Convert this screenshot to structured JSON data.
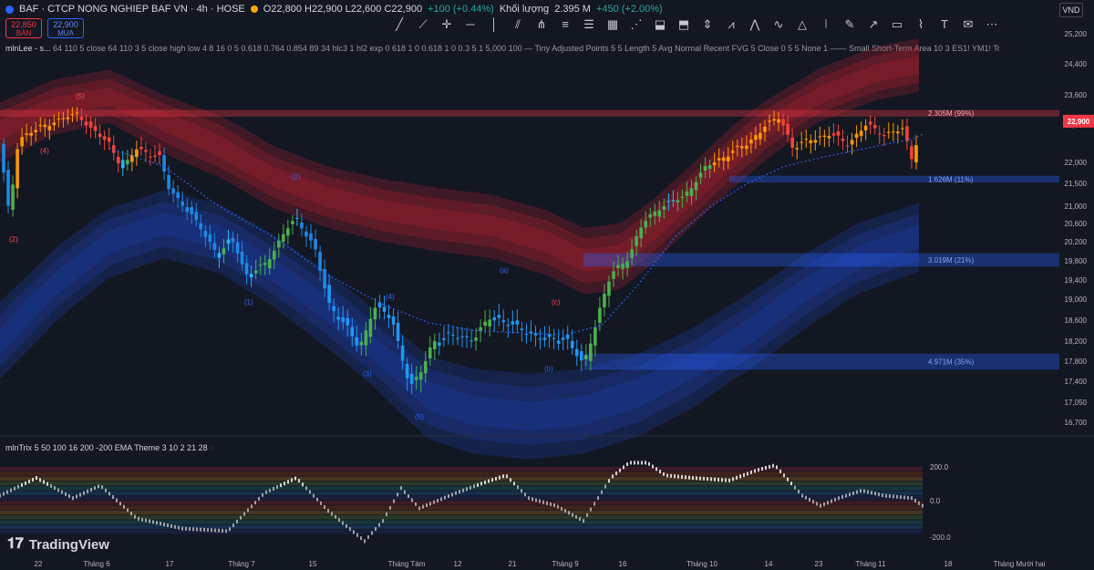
{
  "header": {
    "symbol": "BAF · CTCP NONG NGHIEP BAF VN · 4h · HOSE",
    "ohlc": "O22,800 H22,900 L22,600 C22,900",
    "change": "+100 (+0.44%)",
    "volume_label": "Khối lượng",
    "volume": "2.395 M",
    "volume_change": "+450 (+2.00%)"
  },
  "trade": {
    "sell_price": "22,850",
    "sell_label": "BÁN",
    "buy_price": "22,900",
    "buy_label": "MUA"
  },
  "currency": "VND",
  "indicator_1": {
    "name": "mlnLee - s...",
    "params": "64 110 5 close 64 110 3 5 close high low 4 8 16 0 5 0.618 0.764 0.854 89 34 hlc3 1 hl2 exp 0 618 1 0 0.618 1 0 0.3 5 1 5,000 100 — Tiny Adjusted Points 5 5 Length 5 Avg Normal Recent FVG 5 Close 0 5 5 None 1 —— Small Short-Term Area 10 3 ES1! YM1! Top Right S..."
  },
  "indicator_2": {
    "name": "mlnTrix 5 50 100 16 200 -200 EMA Theme 3 10 2 21 28"
  },
  "tradingview_label": "TradingView",
  "colors": {
    "bg": "#131722",
    "red_band": "#b2222f",
    "blue_band": "#1e40b0",
    "price_tag": "#f23645",
    "grid": "#2a2e39"
  },
  "zones": [
    {
      "label": "2.305M (99%)",
      "top": 23200,
      "bottom": 23020,
      "color": "#f23645"
    },
    {
      "label": "1.626M (11%)",
      "top": 21680,
      "bottom": 21520,
      "color": "#2962ff"
    },
    {
      "label": "3.019M (21%)",
      "top": 19960,
      "bottom": 19680,
      "color": "#2962ff"
    },
    {
      "label": "4.971M (35%)",
      "top": 17950,
      "bottom": 17630,
      "color": "#2962ff"
    }
  ],
  "wave_labels": [
    {
      "text": "(5)",
      "date_index": 83,
      "price": 23500,
      "color": "#ef5350"
    },
    {
      "text": "(4)",
      "date_index": 44,
      "price": 22200,
      "color": "#ef5350"
    },
    {
      "text": "(2)",
      "date_index": 10,
      "price": 20200,
      "color": "#ef5350"
    },
    {
      "text": "(2)",
      "date_index": 320,
      "price": 21600,
      "color": "#2962ff"
    },
    {
      "text": "(1)",
      "date_index": 268,
      "price": 18900,
      "color": "#2962ff"
    },
    {
      "text": "(4)",
      "date_index": 423,
      "price": 19000,
      "color": "#2962ff"
    },
    {
      "text": "(3)",
      "date_index": 398,
      "price": 17500,
      "color": "#2962ff"
    },
    {
      "text": "(5)",
      "date_index": 455,
      "price": 16750,
      "color": "#2962ff"
    },
    {
      "text": "(a)",
      "date_index": 548,
      "price": 19550,
      "color": "#2962ff"
    },
    {
      "text": "(b)",
      "date_index": 597,
      "price": 17600,
      "color": "#2962ff"
    },
    {
      "text": "(c)",
      "date_index": 605,
      "price": 18900,
      "color": "#ef5350"
    }
  ],
  "chart_data": {
    "type": "candlestick",
    "y_ticks": [
      25200,
      24400,
      23600,
      22800,
      22000,
      21500,
      21000,
      20600,
      20200,
      19800,
      19400,
      19000,
      18600,
      18200,
      17800,
      17400,
      17050,
      16700
    ],
    "y_tick_labels": [
      "25,200",
      "24,400",
      "23,600",
      "22,800",
      "22,000",
      "21,500",
      "21,000",
      "20,600",
      "20,200",
      "19,800",
      "19,400",
      "19,000",
      "18,600",
      "18,200",
      "17,800",
      "17,400",
      "17,050",
      "16,700"
    ],
    "ylim": [
      16550,
      25400
    ],
    "last_price": 22900,
    "last_price_label": "22,900",
    "x_tick_labels": [
      "22",
      "Tháng 6",
      "17",
      "Tháng 7",
      "15",
      "Tháng Tám",
      "12",
      "21",
      "Tháng 9",
      "16",
      "Tháng 10",
      "14",
      "23",
      "Tháng 11",
      "18",
      "Tháng Mười hai"
    ],
    "close_path": [
      [
        0,
        22350
      ],
      [
        10,
        20800
      ],
      [
        20,
        22500
      ],
      [
        40,
        22700
      ],
      [
        60,
        22900
      ],
      [
        85,
        23100
      ],
      [
        100,
        22700
      ],
      [
        120,
        22400
      ],
      [
        135,
        21850
      ],
      [
        150,
        22300
      ],
      [
        175,
        22100
      ],
      [
        185,
        21400
      ],
      [
        200,
        21050
      ],
      [
        220,
        20500
      ],
      [
        240,
        19900
      ],
      [
        255,
        20300
      ],
      [
        270,
        19500
      ],
      [
        290,
        19700
      ],
      [
        315,
        20500
      ],
      [
        325,
        20700
      ],
      [
        345,
        20100
      ],
      [
        360,
        18900
      ],
      [
        380,
        18500
      ],
      [
        395,
        18000
      ],
      [
        410,
        18900
      ],
      [
        430,
        18600
      ],
      [
        450,
        17300
      ],
      [
        460,
        17500
      ],
      [
        475,
        18200
      ],
      [
        495,
        18300
      ],
      [
        520,
        18250
      ],
      [
        540,
        18700
      ],
      [
        560,
        18500
      ],
      [
        575,
        18400
      ],
      [
        600,
        18200
      ],
      [
        620,
        18300
      ],
      [
        640,
        17700
      ],
      [
        655,
        18650
      ],
      [
        670,
        19500
      ],
      [
        690,
        19900
      ],
      [
        705,
        20600
      ],
      [
        725,
        21000
      ],
      [
        750,
        21200
      ],
      [
        775,
        21900
      ],
      [
        800,
        22200
      ],
      [
        820,
        22400
      ],
      [
        840,
        22800
      ],
      [
        855,
        23000
      ],
      [
        870,
        22300
      ],
      [
        890,
        22500
      ],
      [
        910,
        22600
      ],
      [
        930,
        22400
      ],
      [
        950,
        22800
      ],
      [
        970,
        22600
      ],
      [
        990,
        22700
      ],
      [
        1000,
        22100
      ],
      [
        1012,
        22900
      ]
    ],
    "ema_path": [
      [
        120,
        22300
      ],
      [
        180,
        21900
      ],
      [
        240,
        21000
      ],
      [
        300,
        20300
      ],
      [
        360,
        19500
      ],
      [
        420,
        18900
      ],
      [
        470,
        18550
      ],
      [
        520,
        18400
      ],
      [
        580,
        18350
      ],
      [
        620,
        18320
      ],
      [
        660,
        18500
      ],
      [
        700,
        19300
      ],
      [
        740,
        20300
      ],
      [
        780,
        21000
      ],
      [
        820,
        21500
      ],
      [
        860,
        21900
      ],
      [
        900,
        22100
      ],
      [
        950,
        22300
      ],
      [
        1000,
        22500
      ],
      [
        1012,
        22600
      ]
    ],
    "red_band": [
      [
        0,
        22700
      ],
      [
        60,
        23300
      ],
      [
        120,
        23550
      ],
      [
        180,
        22900
      ],
      [
        240,
        22350
      ],
      [
        300,
        21650
      ],
      [
        360,
        21200
      ],
      [
        420,
        20900
      ],
      [
        480,
        20700
      ],
      [
        540,
        20550
      ],
      [
        600,
        20200
      ],
      [
        640,
        19800
      ],
      [
        680,
        19900
      ],
      [
        720,
        20500
      ],
      [
        780,
        21650
      ],
      [
        840,
        22750
      ],
      [
        900,
        23600
      ],
      [
        960,
        24150
      ],
      [
        1012,
        24400
      ]
    ],
    "blue_band": [
      [
        0,
        18200
      ],
      [
        60,
        19300
      ],
      [
        120,
        20200
      ],
      [
        180,
        20600
      ],
      [
        240,
        20300
      ],
      [
        300,
        19600
      ],
      [
        360,
        18800
      ],
      [
        420,
        17900
      ],
      [
        470,
        17150
      ],
      [
        520,
        16900
      ],
      [
        580,
        16800
      ],
      [
        640,
        16900
      ],
      [
        700,
        17200
      ],
      [
        760,
        17700
      ],
      [
        820,
        18350
      ],
      [
        880,
        19150
      ],
      [
        940,
        19850
      ],
      [
        1012,
        20350
      ]
    ],
    "trix_path": [
      [
        0,
        0.2
      ],
      [
        40,
        0.9
      ],
      [
        80,
        0.1
      ],
      [
        110,
        0.6
      ],
      [
        150,
        -0.7
      ],
      [
        200,
        -1.1
      ],
      [
        250,
        -1.2
      ],
      [
        290,
        0.3
      ],
      [
        325,
        0.9
      ],
      [
        360,
        -0.4
      ],
      [
        400,
        -1.6
      ],
      [
        420,
        -0.8
      ],
      [
        440,
        0.5
      ],
      [
        460,
        -0.3
      ],
      [
        500,
        0.3
      ],
      [
        530,
        0.7
      ],
      [
        555,
        1.0
      ],
      [
        580,
        0.1
      ],
      [
        610,
        -0.2
      ],
      [
        640,
        -0.8
      ],
      [
        670,
        0.9
      ],
      [
        690,
        1.5
      ],
      [
        710,
        1.5
      ],
      [
        730,
        1.0
      ],
      [
        760,
        0.9
      ],
      [
        800,
        0.8
      ],
      [
        830,
        1.2
      ],
      [
        850,
        1.4
      ],
      [
        880,
        0.2
      ],
      [
        900,
        -0.2
      ],
      [
        920,
        0.1
      ],
      [
        945,
        0.4
      ],
      [
        970,
        0.2
      ],
      [
        1000,
        0.1
      ],
      [
        1012,
        -0.2
      ]
    ],
    "trix_y_labels": [
      "200.0",
      "0.0",
      "-200.0"
    ]
  }
}
